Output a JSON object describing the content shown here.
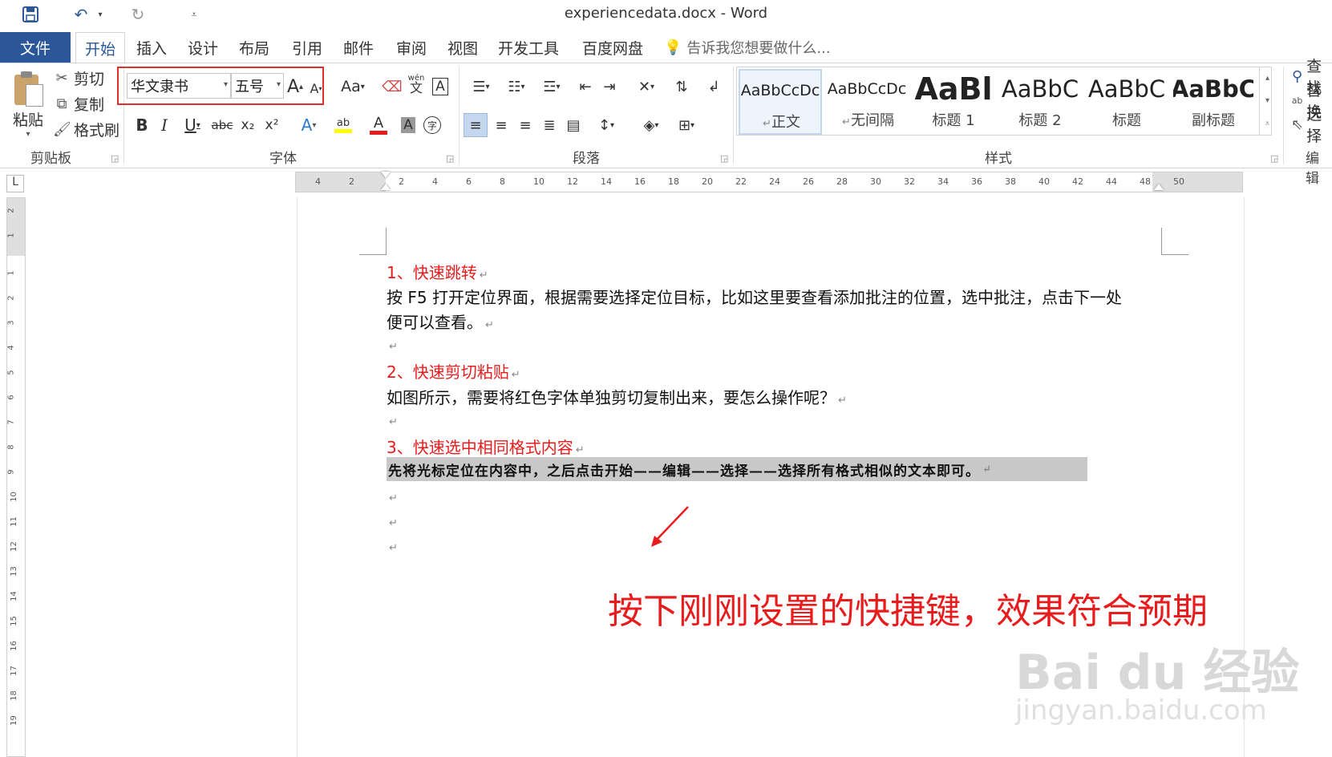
{
  "window": {
    "title": "experiencedata.docx - Word"
  },
  "qat": {
    "save_icon": "save-icon",
    "undo_icon": "undo-icon",
    "redo_icon": "redo-icon",
    "customize_icon": "customize-icon"
  },
  "tabs": {
    "file": "文件",
    "items": [
      {
        "label": "开始",
        "active": true
      },
      {
        "label": "插入"
      },
      {
        "label": "设计"
      },
      {
        "label": "布局"
      },
      {
        "label": "引用"
      },
      {
        "label": "邮件"
      },
      {
        "label": "审阅"
      },
      {
        "label": "视图"
      },
      {
        "label": "开发工具"
      },
      {
        "label": "百度网盘"
      }
    ],
    "tellme": "告诉我您想要做什么..."
  },
  "clipboard": {
    "paste": "粘贴",
    "cut": "剪切",
    "copy": "复制",
    "format_painter": "格式刷",
    "group": "剪贴板"
  },
  "font": {
    "name": "华文隶书",
    "size": "五号",
    "group": "字体",
    "bold": "B",
    "italic": "I",
    "underline": "U",
    "strike": "abc",
    "sub": "x₂",
    "sup": "x²",
    "case": "Aa",
    "grow": "A",
    "shrink": "A",
    "phonetic": "wén",
    "phonetic_char": "文",
    "border_char": "A",
    "effects_char": "A",
    "color_char": "A",
    "shading_char": "A",
    "enclose_char": "字",
    "highlight_char": "ab",
    "accent_color": "#e03131"
  },
  "paragraph": {
    "group": "段落"
  },
  "styles": {
    "group": "样式",
    "items": [
      {
        "preview": "AaBbCcDc",
        "name": "正文",
        "selected": true
      },
      {
        "preview": "AaBbCcDc",
        "name": "无间隔"
      },
      {
        "preview": "AaBl",
        "name": "标题 1"
      },
      {
        "preview": "AaBbC",
        "name": "标题 2"
      },
      {
        "preview": "AaBbC",
        "name": "标题"
      },
      {
        "preview": "AaBbC",
        "name": "副标题"
      }
    ]
  },
  "editing": {
    "group": "编辑",
    "find": "查找",
    "replace": "替换",
    "select": "选择"
  },
  "ruler": {
    "h_ticks": [
      "4",
      "2",
      "2",
      "4",
      "6",
      "8",
      "10",
      "12",
      "14",
      "16",
      "18",
      "20",
      "22",
      "24",
      "26",
      "28",
      "30",
      "32",
      "34",
      "36",
      "38",
      "40",
      "42",
      "44",
      "48",
      "50"
    ],
    "v_ticks": [
      "2",
      "1",
      "1",
      "2",
      "3",
      "4",
      "5",
      "6",
      "7",
      "8",
      "9",
      "10",
      "11",
      "12",
      "13",
      "14",
      "15",
      "16",
      "17",
      "18",
      "19"
    ],
    "corner": "L"
  },
  "document": {
    "lines": [
      {
        "text": "1、快速跳转",
        "red": true
      },
      {
        "text": "按 F5 打开定位界面，根据需要选择定位目标，比如这里要查看添加批注的位置，选中批注，点击下一处"
      },
      {
        "text": "便可以查看。"
      },
      {
        "text": ""
      },
      {
        "text": "2、快速剪切粘贴",
        "red": true
      },
      {
        "text": "如图所示，需要将红色字体单独剪切复制出来，要怎么操作呢？"
      },
      {
        "text": ""
      },
      {
        "text": "3、快速选中相同格式内容",
        "red": true
      }
    ],
    "selected_line": "先将光标定位在内容中，之后点击开始——编辑——选择——选择所有格式相似的文本即可。",
    "paragraph_mark": "↵",
    "annotation": "按下刚刚设置的快捷键，效果符合预期",
    "text_red": "#e81c1c"
  },
  "watermark": {
    "brand": "Bai du 经验",
    "url": "jingyan.baidu.com"
  }
}
